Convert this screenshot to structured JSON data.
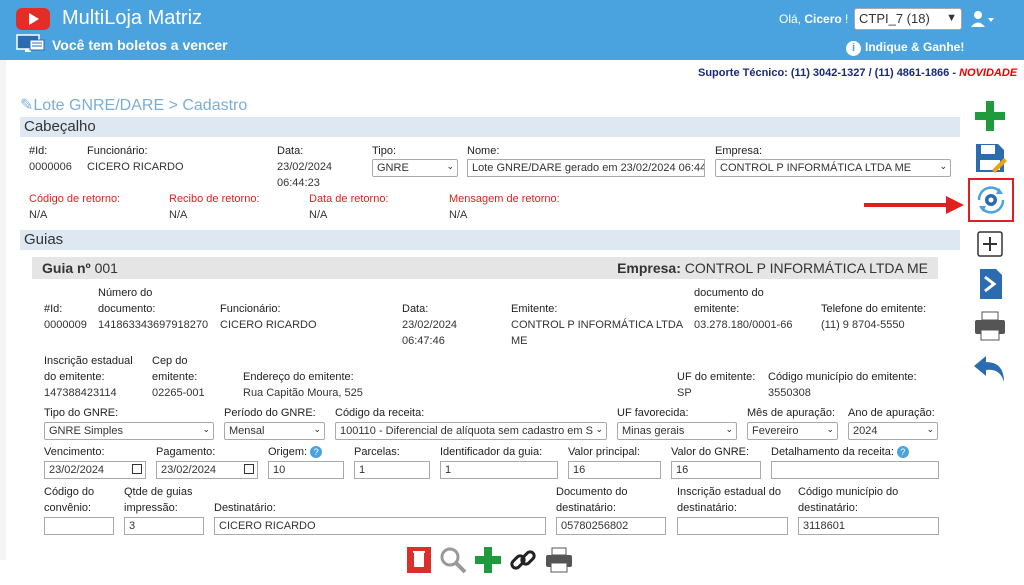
{
  "header": {
    "app_title": "MultiLoja Matriz",
    "boletos_text": "Você tem boletos a vencer",
    "greeting": "Olá,",
    "user_name": "Cicero",
    "store_select": "CTPI_7 (18)",
    "indique_text": "Indique & Ganhe!",
    "support_text": "Suporte Técnico: (11) 3042-1327 / (11) 4861-1866 -",
    "support_novidade": "NOVIDADE"
  },
  "breadcrumb": "Lote GNRE/DARE > Cadastro",
  "cabecalho": {
    "title": "Cabeçalho",
    "id_label": "#Id:",
    "id_value": "0000006",
    "funcionario_label": "Funcionário:",
    "funcionario_value": "CICERO RICARDO",
    "data_label": "Data:",
    "data_value": "23/02/2024",
    "hora_value": "06:44:23",
    "tipo_label": "Tipo:",
    "tipo_value": "GNRE",
    "nome_label": "Nome:",
    "nome_value": "Lote GNRE/DARE gerado em 23/02/2024 06:44",
    "empresa_label": "Empresa:",
    "empresa_value": "CONTROL P INFORMÁTICA LTDA ME",
    "cod_retorno_label": "Código de retorno:",
    "cod_retorno_value": "N/A",
    "recibo_label": "Recibo de retorno:",
    "recibo_value": "N/A",
    "data_retorno_label": "Data de retorno:",
    "data_retorno_value": "N/A",
    "mensagem_label": "Mensagem de retorno:",
    "mensagem_value": "N/A"
  },
  "guias": {
    "title": "Guias",
    "guia_label": "Guia nº",
    "guia_number": "001",
    "empresa_label": "Empresa:",
    "empresa_value": "CONTROL P INFORMÁTICA LTDA ME",
    "id_label": "#Id:",
    "id_value": "0000009",
    "numdoc_label1": "Número do",
    "numdoc_label2": "documento:",
    "numdoc_value": "141863343697918270",
    "funcionario_label": "Funcionário:",
    "funcionario_value": "CICERO RICARDO",
    "data_label": "Data:",
    "data_value": "23/02/2024",
    "hora_value": "06:47:46",
    "emitente_label": "Emitente:",
    "emitente_value1": "CONTROL P INFORMÁTICA LTDA",
    "emitente_value2": "ME",
    "docemit_label1": "documento do",
    "docemit_label2": "emitente:",
    "docemit_value": "03.278.180/0001-66",
    "tel_label": "Telefone do emitente:",
    "tel_value": "(11) 9 8704-5550",
    "ie_label1": "Inscrição estadual",
    "ie_label2": "do emitente:",
    "ie_value": "147388423114",
    "cep_label1": "Cep do",
    "cep_label2": "emitente:",
    "cep_value": "02265-001",
    "endereco_label": "Endereço do emitente:",
    "endereco_value": "Rua Capitão Moura, 525",
    "uf_label": "UF do emitente:",
    "uf_value": "SP",
    "codmun_label": "Código município do emitente:",
    "codmun_value": "3550308",
    "tipo_gnre_label": "Tipo do GNRE:",
    "tipo_gnre_value": "GNRE Simples",
    "periodo_label": "Período do GNRE:",
    "periodo_value": "Mensal",
    "codreceita_label": "Código da receita:",
    "codreceita_value": "100110 - Diferencial de alíquota sem cadastro em S",
    "uffav_label": "UF favorecida:",
    "uffav_value": "Minas gerais",
    "mes_label": "Mês de apuração:",
    "mes_value": "Fevereiro",
    "ano_label": "Ano de apuração:",
    "ano_value": "2024",
    "vencimento_label": "Vencimento:",
    "vencimento_value": "23/02/2024",
    "pagamento_label": "Pagamento:",
    "pagamento_value": "23/02/2024",
    "origem_label": "Origem:",
    "origem_value": "10",
    "parcelas_label": "Parcelas:",
    "parcelas_value": "1",
    "identificador_label": "Identificador da guia:",
    "identificador_value": "1",
    "valorprincipal_label": "Valor principal:",
    "valorprincipal_value": "16",
    "valorgnre_label": "Valor do GNRE:",
    "valorgnre_value": "16",
    "detalhamento_label": "Detalhamento da receita:",
    "detalhamento_value": "",
    "codconvenio_label1": "Código do",
    "codconvenio_label2": "convênio:",
    "codconvenio_value": "",
    "qtde_label1": "Qtde de guias",
    "qtde_label2": "impressão:",
    "qtde_value": "3",
    "destinatario_label": "Destinatário:",
    "destinatario_value": "CICERO RICARDO",
    "docdest_label1": "Documento do",
    "docdest_label2": "destinatário:",
    "docdest_value": "05780256802",
    "iedest_label1": "Inscrição estadual do",
    "iedest_label2": "destinatário:",
    "iedest_value": "",
    "codmundest_label1": "Código município do",
    "codmundest_label2": "destinatário:",
    "codmundest_value": "3118601"
  },
  "colors": {
    "topbar": "#4aa3df",
    "section_bar": "#dde8f2",
    "green": "#1f9a3c",
    "blue": "#2b6cb0",
    "red_arrow": "#e02020",
    "label_red": "#e02020"
  }
}
